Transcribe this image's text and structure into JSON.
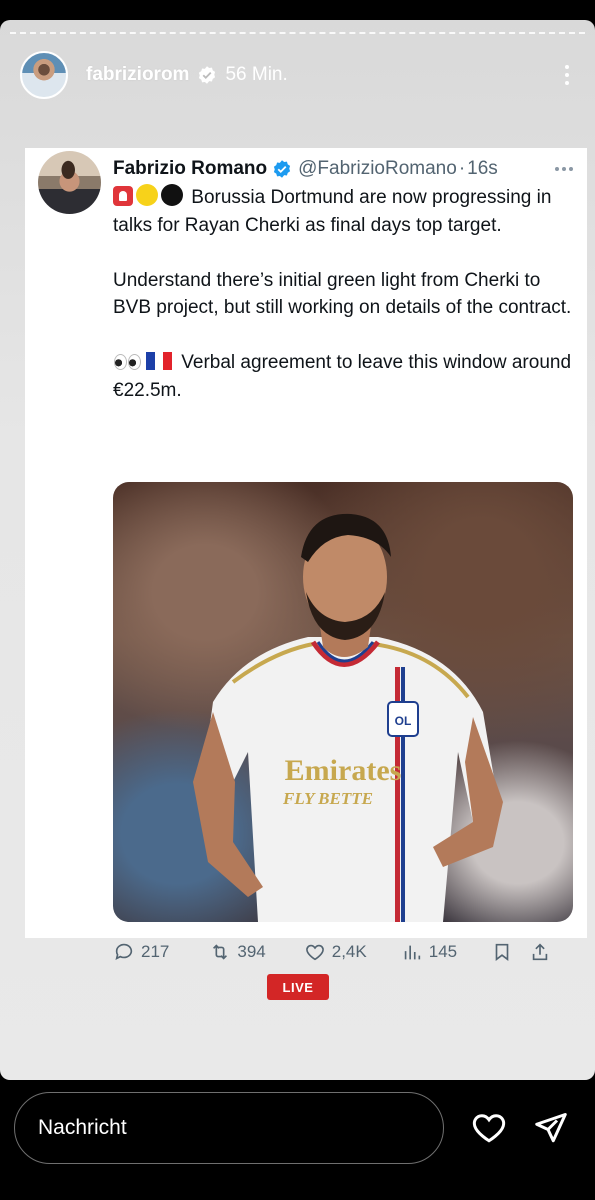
{
  "story": {
    "username": "fabriziorom",
    "time": "56 Min."
  },
  "tweet": {
    "name": "Fabrizio Romano",
    "handle": "@FabrizioRomano",
    "separator": "·",
    "age": "16s",
    "line1": "Borussia Dortmund are now progressing in talks for Rayan Cherki as final days top target.",
    "para2": "Understand there’s initial green light from Cherki to BVB project, but still working on details of the contract.",
    "para3": "Verbal agreement to leave this window around €22.5m.",
    "media": {
      "jersey_sponsor_line1": "Emirates",
      "jersey_sponsor_line2": "FLY BETTE",
      "club_badge": "OL"
    },
    "actions": {
      "replies": "217",
      "reposts": "394",
      "likes": "2,4K",
      "views": "145"
    }
  },
  "badge": {
    "live": "LIVE"
  },
  "composer": {
    "placeholder": "Nachricht"
  },
  "colors": {
    "verified": "#1d9bf0",
    "live": "#d32626",
    "text": "#0f1419",
    "muted": "#536471"
  }
}
